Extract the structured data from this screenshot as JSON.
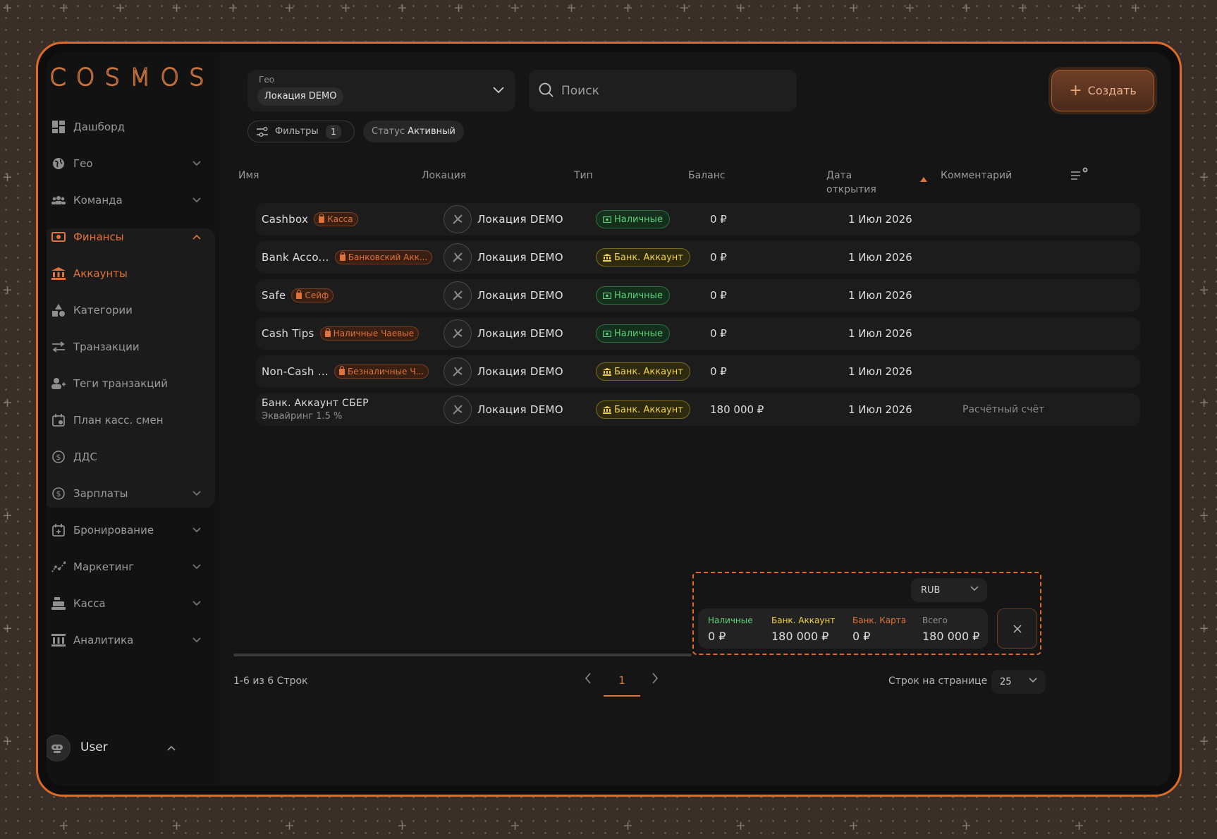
{
  "app": {
    "logo": "COSMOS"
  },
  "sidebar": {
    "items": [
      {
        "label": "Дашборд",
        "icon": "dashboard-icon"
      },
      {
        "label": "Гео",
        "icon": "globe-icon"
      },
      {
        "label": "Команда",
        "icon": "team-icon"
      },
      {
        "label": "Финансы",
        "icon": "finance-icon"
      },
      {
        "label": "Аккаунты",
        "icon": "bank-icon"
      },
      {
        "label": "Категории",
        "icon": "shapes-icon"
      },
      {
        "label": "Транзакции",
        "icon": "transfer-icon"
      },
      {
        "label": "Теги транзакций",
        "icon": "tag-user-icon"
      },
      {
        "label": "План касс. смен",
        "icon": "calendar-icon"
      },
      {
        "label": "ДДС",
        "icon": "dollar-circle-icon"
      },
      {
        "label": "Зарплаты",
        "icon": "dollar-circle-icon"
      },
      {
        "label": "Бронирование",
        "icon": "calendar-plus-icon"
      },
      {
        "label": "Маркетинг",
        "icon": "chart-line-icon"
      },
      {
        "label": "Касса",
        "icon": "cash-register-icon"
      },
      {
        "label": "Аналитика",
        "icon": "analytics-icon"
      }
    ],
    "user": {
      "name": "User"
    }
  },
  "geo": {
    "caption": "Гео",
    "value": "Локация DEMO"
  },
  "search": {
    "placeholder": "Поиск"
  },
  "create_label": "Создать",
  "filters": {
    "label": "Фильтры",
    "count": "1",
    "status_label": "Статус",
    "status_value": "Активный"
  },
  "table": {
    "headers": {
      "name": "Имя",
      "location": "Локация",
      "type": "Тип",
      "balance": "Баланс",
      "date_line1": "Дата",
      "date_line2": "открытия",
      "comment": "Комментарий"
    },
    "rows": [
      {
        "name": "Cashbox",
        "tag": "Касса",
        "location": "Локация DEMO",
        "type": "Наличные",
        "balance": "0 ₽",
        "date": "1 Июл 2026",
        "comment": ""
      },
      {
        "name": "Bank Acco...",
        "tag": "Банковский Акк...",
        "location": "Локация DEMO",
        "type": "Банк. Аккаунт",
        "balance": "0 ₽",
        "date": "1 Июл 2026",
        "comment": ""
      },
      {
        "name": "Safe",
        "tag": "Сейф",
        "location": "Локация DEMO",
        "type": "Наличные",
        "balance": "0 ₽",
        "date": "1 Июл 2026",
        "comment": ""
      },
      {
        "name": "Cash Tips",
        "tag": "Наличные Чаевые",
        "location": "Локация DEMO",
        "type": "Наличные",
        "balance": "0 ₽",
        "date": "1 Июл 2026",
        "comment": ""
      },
      {
        "name": "Non-Cash ...",
        "tag": "Безналичные Ч...",
        "location": "Локация DEMO",
        "type": "Банк. Аккаунт",
        "balance": "0 ₽",
        "date": "1 Июл 2026",
        "comment": ""
      },
      {
        "name": "Банк. Аккаунт СБЕР",
        "sub": "Эквайринг 1.5 %",
        "location": "Локация DEMO",
        "type": "Банк. Аккаунт",
        "balance": "180 000 ₽",
        "date": "1 Июл 2026",
        "comment": "Расчётный счёт"
      }
    ]
  },
  "summary": {
    "currency": "RUB",
    "cash_label": "Наличные",
    "cash_value": "0 ₽",
    "bank_label": "Банк. Аккаунт",
    "bank_value": "180 000 ₽",
    "card_label": "Банк. Карта",
    "card_value": "0 ₽",
    "total_label": "Всего",
    "total_value": "180 000 ₽"
  },
  "pagination": {
    "info": "1-6 из 6 Строк",
    "page": "1",
    "per_page_label": "Строк на странице",
    "per_page": "25"
  },
  "colors": {
    "accent": "#e0733b",
    "cash": "#5ed17a",
    "bank": "#f0d34a",
    "card": "#e0733b"
  }
}
